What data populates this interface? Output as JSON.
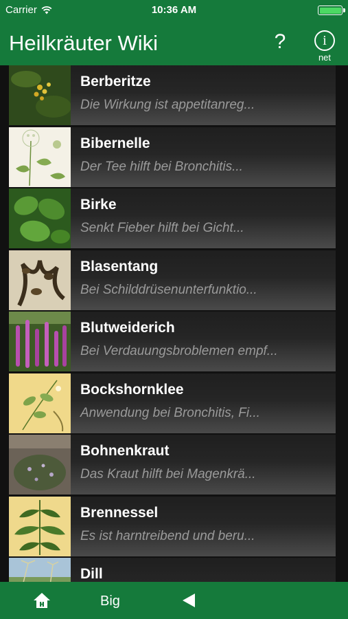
{
  "status": {
    "carrier": "Carrier",
    "time": "10:36 AM"
  },
  "header": {
    "title": "Heilkräuter Wiki",
    "help_label": "?",
    "info_label": "i",
    "info_sub": "net"
  },
  "plants": [
    {
      "name": "Berberitze",
      "desc": "Die Wirkung ist appetitanreg..."
    },
    {
      "name": "Bibernelle",
      "desc": "Der Tee hilft bei Bronchitis..."
    },
    {
      "name": "Birke",
      "desc": "Senkt Fieber hilft bei Gicht..."
    },
    {
      "name": "Blasentang",
      "desc": "Bei Schilddrüsenunterfunktio..."
    },
    {
      "name": "Blutweiderich",
      "desc": "Bei Verdauungsbroblemen empf..."
    },
    {
      "name": "Bockshornklee",
      "desc": "Anwendung bei Bronchitis, Fi..."
    },
    {
      "name": "Bohnenkraut",
      "desc": "Das Kraut hilft bei Magenkrä..."
    },
    {
      "name": "Brennessel",
      "desc": "Es ist harntreibend und beru..."
    },
    {
      "name": "Dill",
      "desc": ""
    }
  ],
  "tabbar": {
    "big_label": "Big"
  },
  "colors": {
    "brand_green": "#157a3b",
    "row_background": "#262626",
    "desc_text": "#9a9a9a"
  }
}
